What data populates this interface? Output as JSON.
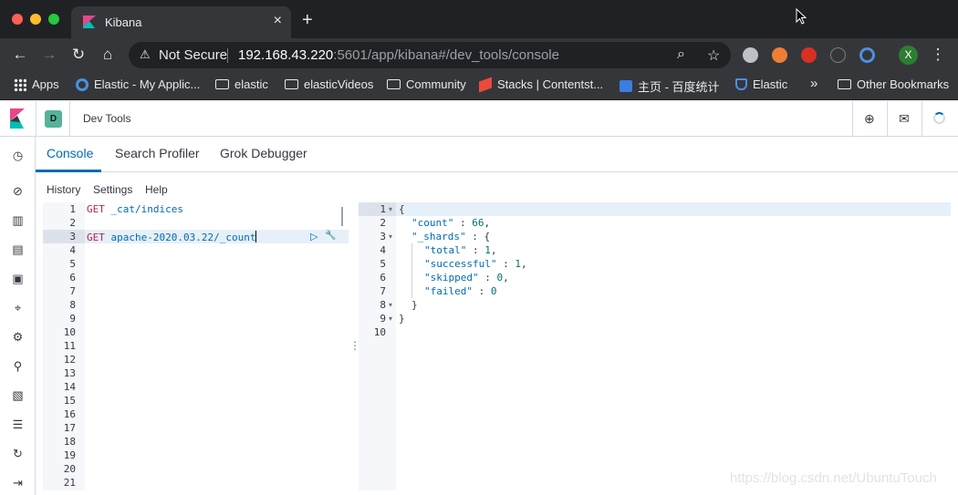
{
  "browser": {
    "tab_title": "Kibana",
    "tab_close": "×",
    "new_tab": "+",
    "security_label": "Not Secure",
    "url_host": "192.168.43.220",
    "url_path": ":5601/app/kibana#/dev_tools/console",
    "profile_initial": "X",
    "icons": [
      "back-icon",
      "forward-icon",
      "reload-icon",
      "home-icon",
      "zoom-icon",
      "star-icon",
      "menu-icon"
    ]
  },
  "bookmarks": {
    "items": [
      {
        "label": "Apps",
        "icon": "apps-grid-icon"
      },
      {
        "label": "Elastic - My Applic...",
        "icon": "elastic-favicon"
      },
      {
        "label": "elastic",
        "icon": "folder-icon"
      },
      {
        "label": "elasticVideos",
        "icon": "folder-icon"
      },
      {
        "label": "Community",
        "icon": "folder-icon"
      },
      {
        "label": "Stacks | Contentst...",
        "icon": "contentstack-favicon"
      },
      {
        "label": "主页 - 百度统计",
        "icon": "baidu-tongji-favicon"
      },
      {
        "label": "Elastic",
        "icon": "elastic-favicon"
      }
    ],
    "overflow": "»",
    "other": "Other Bookmarks"
  },
  "kibana": {
    "space_initial": "D",
    "header_title": "Dev Tools",
    "tabs": [
      "Console",
      "Search Profiler",
      "Grok Debugger"
    ],
    "console_menu": [
      "History",
      "Settings",
      "Help"
    ],
    "nav_icons": [
      "recent-clock-icon",
      "discover-compass-icon",
      "visualize-icon",
      "dashboard-icon",
      "canvas-icon",
      "maps-icon",
      "ml-icon",
      "siem-icon",
      "logs-icon",
      "infrastructure-icon",
      "uptime-icon",
      "collapse-nav-icon"
    ]
  },
  "editor": {
    "line_numbers": [
      "1",
      "2",
      "3",
      "4",
      "5",
      "6",
      "7",
      "8",
      "9",
      "10",
      "11",
      "12",
      "13",
      "14",
      "15",
      "16",
      "17",
      "18",
      "19",
      "20",
      "21"
    ],
    "line1_method": "GET",
    "line1_path": " _cat/indices",
    "line3_method": "GET",
    "line3_path": " apache-2020.03.22/_count",
    "run_icon": "▷",
    "wrench_icon": "🔧",
    "resizer": "⋮"
  },
  "output": {
    "line_numbers": [
      "1",
      "2",
      "3",
      "4",
      "5",
      "6",
      "7",
      "8",
      "9",
      "10"
    ],
    "lines": [
      {
        "text": "{"
      },
      {
        "key": "\"count\"",
        "sep": " : ",
        "val": "66",
        "end": ","
      },
      {
        "key": "\"_shards\"",
        "sep": " : ",
        "val": "",
        "end": "{"
      },
      {
        "key": "\"total\"",
        "sep": " : ",
        "val": "1",
        "end": ","
      },
      {
        "key": "\"successful\"",
        "sep": " : ",
        "val": "1",
        "end": ","
      },
      {
        "key": "\"skipped\"",
        "sep": " : ",
        "val": "0",
        "end": ","
      },
      {
        "key": "\"failed\"",
        "sep": " : ",
        "val": "0",
        "end": ""
      },
      {
        "text": "}"
      },
      {
        "text": "}"
      },
      {
        "text": ""
      }
    ]
  },
  "watermark": "https://blog.csdn.net/UbuntuTouch"
}
